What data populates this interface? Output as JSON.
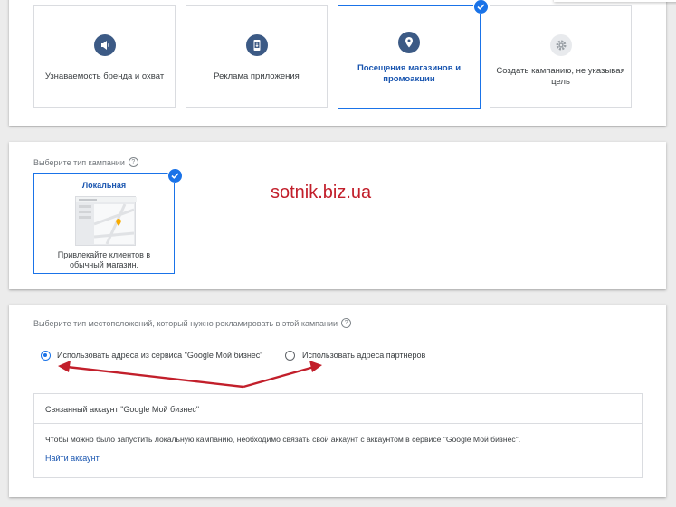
{
  "watermark": "sotnik.biz.ua",
  "goals": {
    "items": [
      {
        "label": "Узнаваемость бренда и охват",
        "icon": "megaphone-icon"
      },
      {
        "label": "Реклама приложения",
        "icon": "phone-icon"
      },
      {
        "label": "Посещения магазинов и промоакции",
        "icon": "location-pin-icon",
        "selected": true
      },
      {
        "label": "Создать кампанию, не указывая цель",
        "icon": "gear-icon"
      }
    ]
  },
  "campaign_type": {
    "label": "Выберите тип кампании",
    "card_title": "Локальная",
    "card_description": "Привлекайте клиентов в обычный магазин."
  },
  "locations": {
    "label": "Выберите тип местоположений, который нужно рекламировать в этой кампании",
    "options": [
      {
        "label": "Использовать адреса из сервиса \"Google Мой бизнес\"",
        "checked": true
      },
      {
        "label": "Использовать адреса партнеров",
        "checked": false
      }
    ],
    "linked_account": {
      "title": "Связанный аккаунт \"Google Мой бизнес\"",
      "message": "Чтобы можно было запустить локальную кампанию, необходимо связать свой аккаунт с аккаунтом в сервисе \"Google Мой бизнес\".",
      "link": "Найти аккаунт"
    }
  },
  "colors": {
    "accent": "#1a73e8",
    "annotation": "#c21f2b"
  }
}
